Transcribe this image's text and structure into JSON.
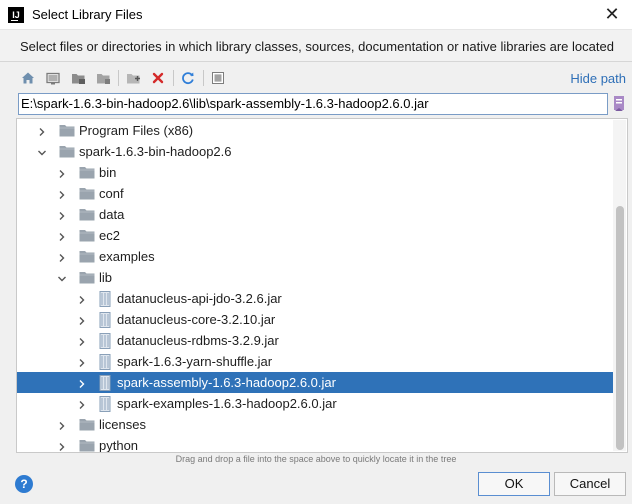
{
  "window": {
    "title": "Select Library Files",
    "close_glyph": "✕"
  },
  "description": "Select files or directories in which library classes, sources, documentation or native libraries are located",
  "toolbar": {
    "buttons": [
      "home-icon",
      "desktop-icon",
      "project-folder-icon",
      "module-folder-icon",
      "new-folder-icon",
      "delete-icon",
      "refresh-icon",
      "show-hidden-icon"
    ],
    "hide_path_label": "Hide path"
  },
  "path": {
    "value": "E:\\spark-1.6.3-bin-hadoop2.6\\lib\\spark-assembly-1.6.3-hadoop2.6.0.jar"
  },
  "tree": {
    "rows": [
      {
        "label": "Program Files (x86)",
        "type": "folder",
        "depth": 0,
        "expanded": false,
        "selected": false
      },
      {
        "label": "spark-1.6.3-bin-hadoop2.6",
        "type": "folder",
        "depth": 0,
        "expanded": true,
        "selected": false
      },
      {
        "label": "bin",
        "type": "folder",
        "depth": 1,
        "expanded": false,
        "selected": false
      },
      {
        "label": "conf",
        "type": "folder",
        "depth": 1,
        "expanded": false,
        "selected": false
      },
      {
        "label": "data",
        "type": "folder",
        "depth": 1,
        "expanded": false,
        "selected": false
      },
      {
        "label": "ec2",
        "type": "folder",
        "depth": 1,
        "expanded": false,
        "selected": false
      },
      {
        "label": "examples",
        "type": "folder",
        "depth": 1,
        "expanded": false,
        "selected": false
      },
      {
        "label": "lib",
        "type": "folder",
        "depth": 1,
        "expanded": true,
        "selected": false
      },
      {
        "label": "datanucleus-api-jdo-3.2.6.jar",
        "type": "jar",
        "depth": 2,
        "expanded": false,
        "selected": false
      },
      {
        "label": "datanucleus-core-3.2.10.jar",
        "type": "jar",
        "depth": 2,
        "expanded": false,
        "selected": false
      },
      {
        "label": "datanucleus-rdbms-3.2.9.jar",
        "type": "jar",
        "depth": 2,
        "expanded": false,
        "selected": false
      },
      {
        "label": "spark-1.6.3-yarn-shuffle.jar",
        "type": "jar",
        "depth": 2,
        "expanded": false,
        "selected": false
      },
      {
        "label": "spark-assembly-1.6.3-hadoop2.6.0.jar",
        "type": "jar",
        "depth": 2,
        "expanded": false,
        "selected": true
      },
      {
        "label": "spark-examples-1.6.3-hadoop2.6.0.jar",
        "type": "jar",
        "depth": 2,
        "expanded": false,
        "selected": false
      },
      {
        "label": "licenses",
        "type": "folder",
        "depth": 1,
        "expanded": false,
        "selected": false
      },
      {
        "label": "python",
        "type": "folder",
        "depth": 1,
        "expanded": false,
        "selected": false
      }
    ]
  },
  "hint": "Drag and drop a file into the space above to quickly locate it in the tree",
  "footer": {
    "help_glyph": "?",
    "ok_label": "OK",
    "cancel_label": "Cancel"
  },
  "colors": {
    "selection": "#2f72b8",
    "link": "#2e6fb7",
    "folder": "#9aa4ae",
    "jar": "#8aa0b8"
  }
}
